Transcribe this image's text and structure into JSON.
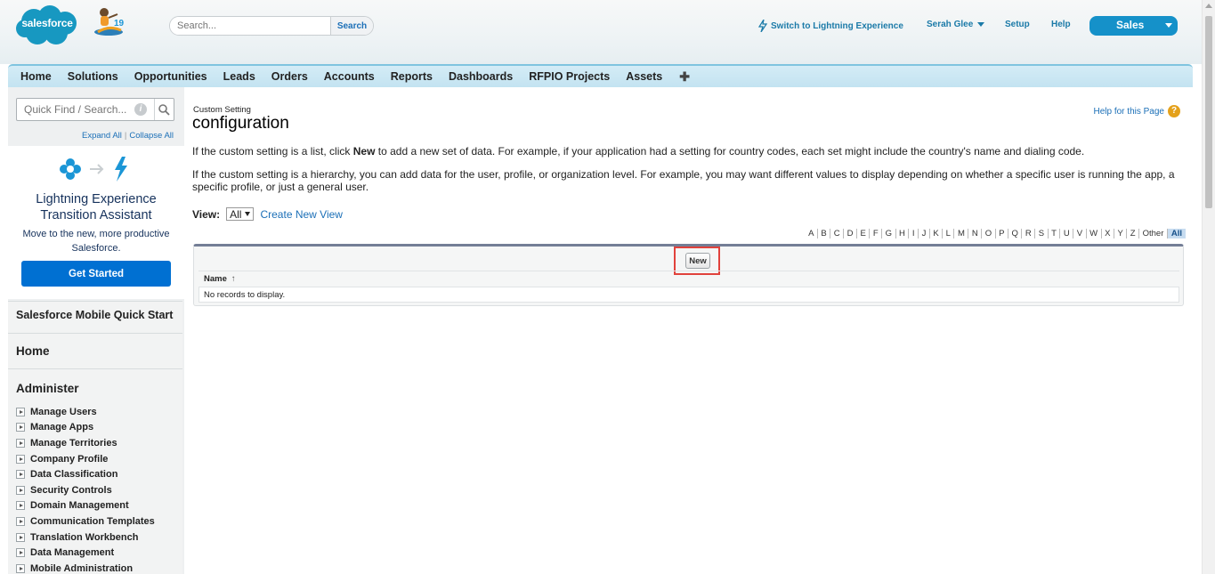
{
  "header": {
    "logo_text": "salesforce",
    "release_badge": "19",
    "search_placeholder": "Search...",
    "search_button": "Search",
    "lightning_link": "Switch to Lightning Experience",
    "user_name": "Serah Glee",
    "setup": "Setup",
    "help": "Help",
    "app_name": "Sales",
    "colors": {
      "brand": "#00a1e0",
      "app_menu": "#1591c9",
      "link": "#1b7aa8"
    }
  },
  "tabs": [
    "Home",
    "Solutions",
    "Opportunities",
    "Leads",
    "Orders",
    "Accounts",
    "Reports",
    "Dashboards",
    "RFPIO Projects",
    "Assets"
  ],
  "tab_plus_icon": "plus-icon",
  "sidebar": {
    "quick_find_placeholder": "Quick Find / Search...",
    "expand_all": "Expand All",
    "collapse_all": "Collapse All",
    "separator": "|",
    "assistant": {
      "title": "Lightning Experience Transition Assistant",
      "subtitle": "Move to the new, more productive Salesforce.",
      "button": "Get Started",
      "button_color": "#0070d2"
    },
    "mobile_quick_start": "Salesforce Mobile Quick Start",
    "home": "Home",
    "administer": "Administer",
    "admin_items": [
      "Manage Users",
      "Manage Apps",
      "Manage Territories",
      "Company Profile",
      "Data Classification",
      "Security Controls",
      "Domain Management",
      "Communication Templates",
      "Translation Workbench",
      "Data Management",
      "Mobile Administration"
    ]
  },
  "main": {
    "breadcrumb": "Custom Setting",
    "title": "configuration",
    "help_page": "Help for this Page",
    "help_icon_glyph": "?",
    "desc1_before": "If the custom setting is a list, click ",
    "desc1_bold": "New",
    "desc1_after": " to add a new set of data. For example, if your application had a setting for country codes, each set might include the country's name and dialing code.",
    "desc2": "If the custom setting is a hierarchy, you can add data for the user, profile, or organization level. For example, you may want different values to display depending on whether a specific user is running the app, a specific profile, or just a general user.",
    "view_label": "View:",
    "view_selected": "All",
    "create_view": "Create New View",
    "alphabet": [
      "A",
      "B",
      "C",
      "D",
      "E",
      "F",
      "G",
      "H",
      "I",
      "J",
      "K",
      "L",
      "M",
      "N",
      "O",
      "P",
      "Q",
      "R",
      "S",
      "T",
      "U",
      "V",
      "W",
      "X",
      "Y",
      "Z",
      "Other",
      "All"
    ],
    "new_button": "New",
    "column_name": "Name",
    "sort_arrow": "↑",
    "empty_message": "No records to display.",
    "highlight_color": "#e1423c"
  }
}
